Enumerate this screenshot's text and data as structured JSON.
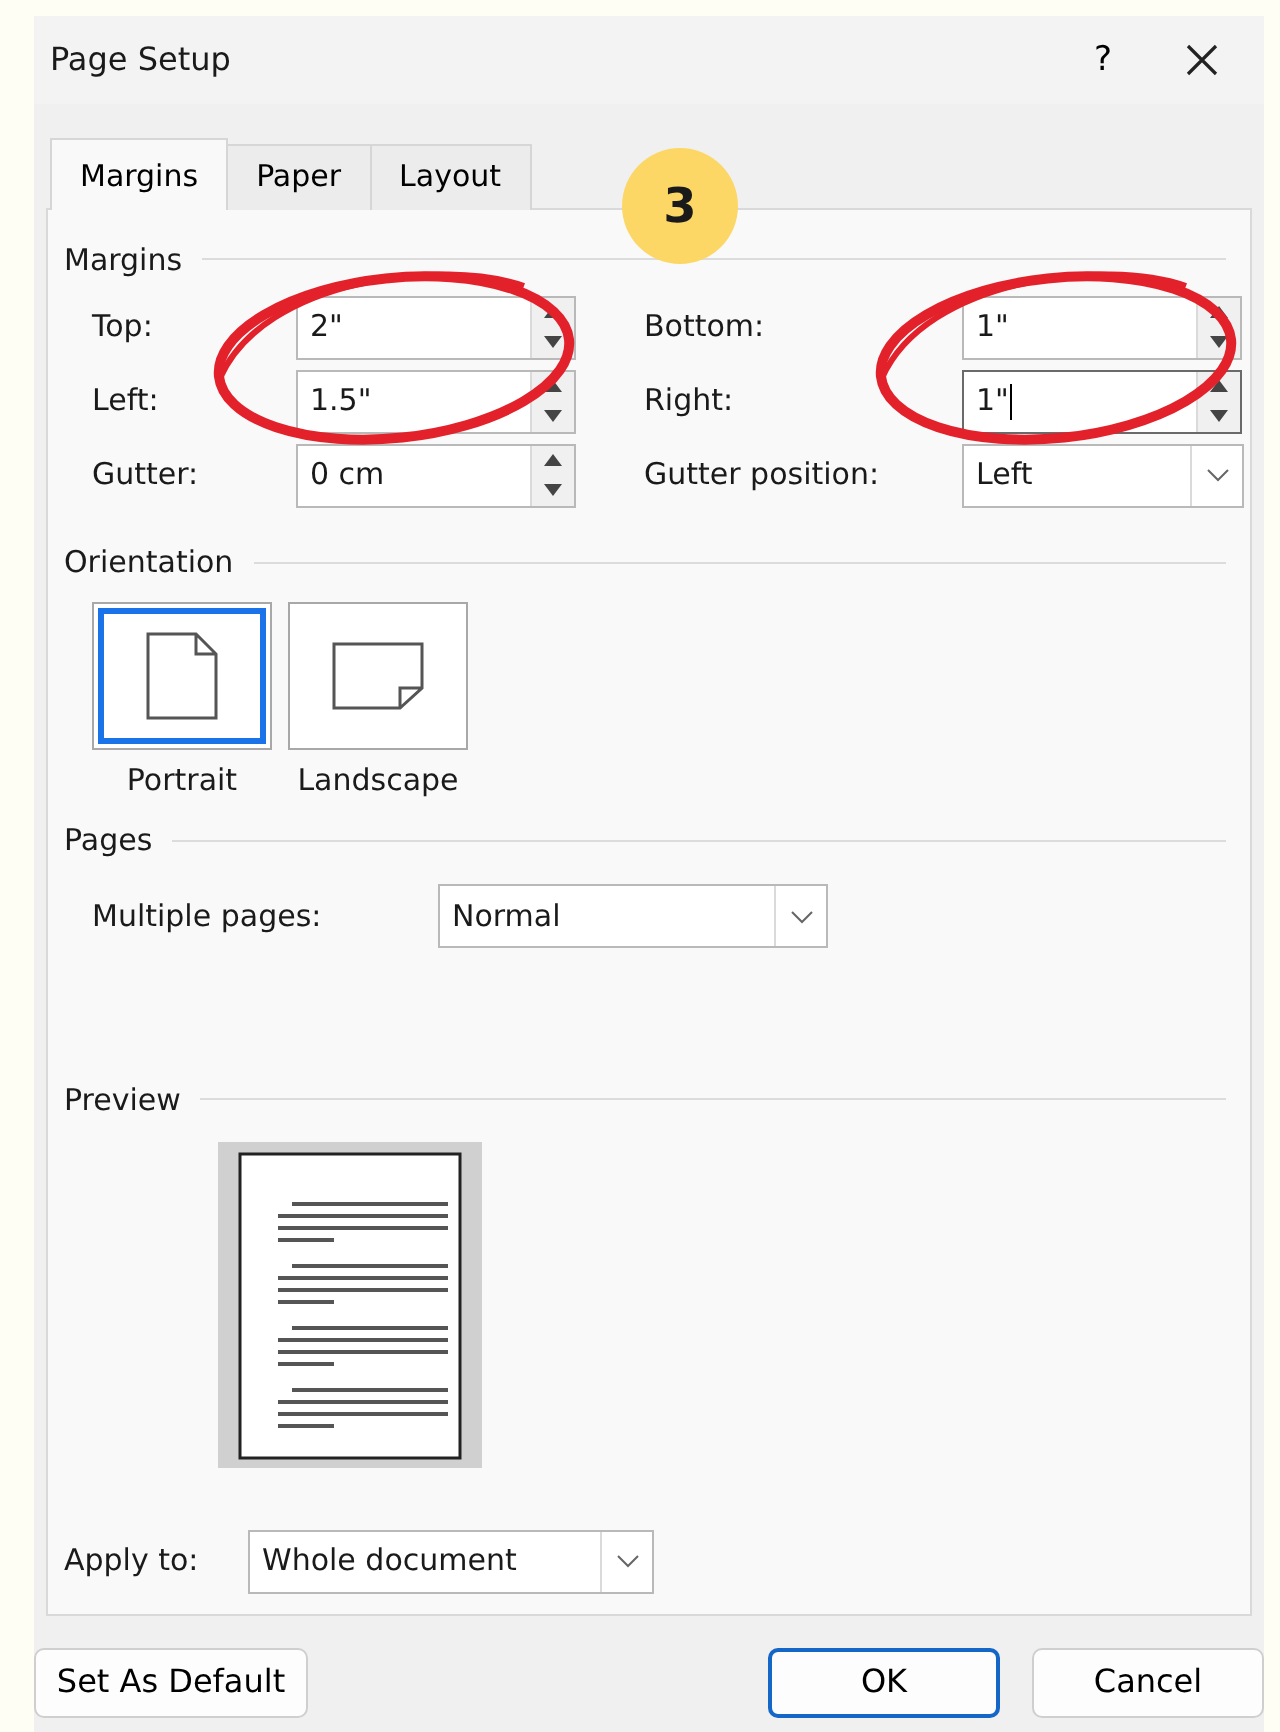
{
  "window": {
    "title": "Page Setup",
    "help": "?"
  },
  "tabs": [
    {
      "label": "Margins",
      "selected": true
    },
    {
      "label": "Paper",
      "selected": false
    },
    {
      "label": "Layout",
      "selected": false
    }
  ],
  "step_badge": "3",
  "margins": {
    "heading": "Margins",
    "columns": [
      {
        "circled": true,
        "rows": [
          {
            "kind": "spin",
            "label": "Top:",
            "value": "2\"",
            "focused": false
          },
          {
            "kind": "spin",
            "label": "Left:",
            "value": "1.5\"",
            "focused": false
          },
          {
            "kind": "spin",
            "label": "Gutter:",
            "value": "0 cm",
            "focused": false
          }
        ]
      },
      {
        "circled": true,
        "rows": [
          {
            "kind": "spin",
            "label": "Bottom:",
            "value": "1\"",
            "focused": false
          },
          {
            "kind": "spin",
            "label": "Right:",
            "value": "1\"",
            "focused": true
          },
          {
            "kind": "select",
            "label": "Gutter position:",
            "value": "Left"
          }
        ]
      }
    ]
  },
  "orientation": {
    "heading": "Orientation",
    "options": [
      {
        "kind": "portrait",
        "label": "Portrait",
        "selected": true
      },
      {
        "kind": "landscape",
        "label": "Landscape",
        "selected": false
      }
    ]
  },
  "pages": {
    "heading": "Pages",
    "label": "Multiple pages:",
    "value": "Normal"
  },
  "preview": {
    "heading": "Preview"
  },
  "apply_to": {
    "label": "Apply to:",
    "value": "Whole document"
  },
  "buttons": [
    {
      "label": "Set As Default",
      "default": false
    },
    {
      "label": "OK",
      "default": true
    },
    {
      "label": "Cancel",
      "default": false
    }
  ]
}
